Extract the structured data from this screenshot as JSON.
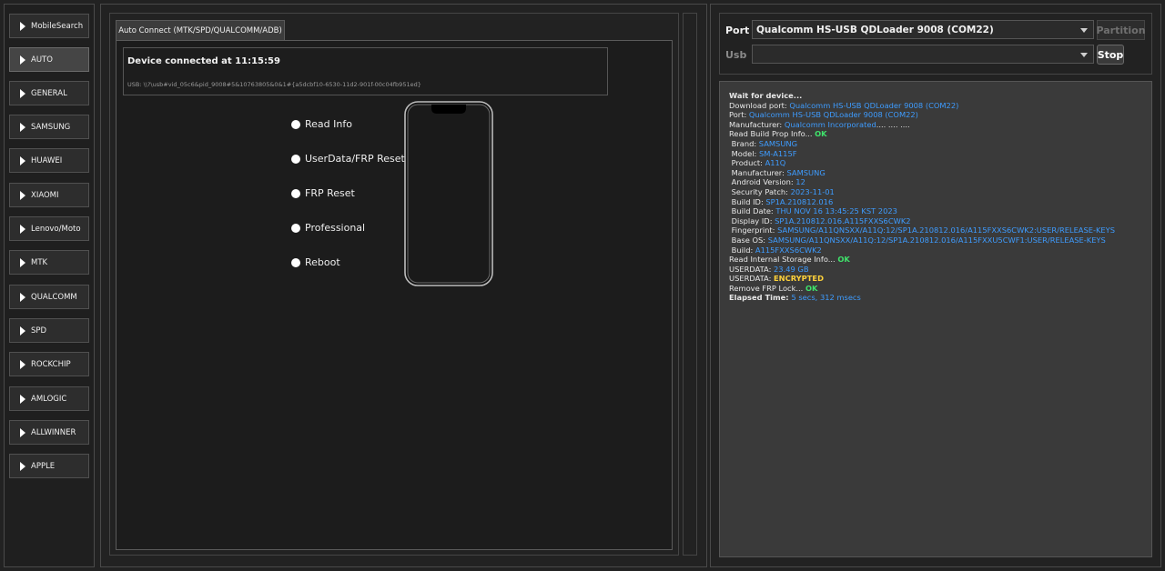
{
  "sidebar": {
    "items": [
      {
        "label": "MobileSearch"
      },
      {
        "label": "AUTO"
      },
      {
        "label": "GENERAL"
      },
      {
        "label": "SAMSUNG"
      },
      {
        "label": "HUAWEI"
      },
      {
        "label": "XIAOMI"
      },
      {
        "label": "Lenovo/Moto"
      },
      {
        "label": "MTK"
      },
      {
        "label": "QUALCOMM"
      },
      {
        "label": "SPD"
      },
      {
        "label": "ROCKCHIP"
      },
      {
        "label": "AMLOGIC"
      },
      {
        "label": "ALLWINNER"
      },
      {
        "label": "APPLE"
      }
    ],
    "active": "AUTO"
  },
  "main": {
    "tab_label": "Auto Connect (MTK/SPD/QUALCOMM/ADB)",
    "status_title": "Device connected at 11:15:59",
    "usb_path": "USB: \\\\?\\usb#vid_05c6&pid_9008#5&10763805&0&1#{a5dcbf10-6530-11d2-901f-00c04fb951ed}",
    "options": [
      {
        "label": "Read Info"
      },
      {
        "label": "UserData/FRP Reset"
      },
      {
        "label": "FRP Reset"
      },
      {
        "label": "Professional"
      },
      {
        "label": "Reboot"
      }
    ]
  },
  "right": {
    "port_label": "Port",
    "port_value": "Qualcomm HS-USB QDLoader 9008 (COM22)",
    "usb_label": "Usb",
    "usb_value": "",
    "partition_label": "Partition",
    "stop_label": "Stop",
    "colors": {
      "value": "#3e9cff",
      "ok": "#3fe36b",
      "warn": "#ffd23a"
    }
  },
  "log": [
    {
      "key": "Wait for device...",
      "bold": true
    },
    {
      "key": "Download port: ",
      "value": "Qualcomm HS-USB QDLoader 9008 (COM22)"
    },
    {
      "key": "Port: ",
      "value": "Qualcomm HS-USB QDLoader 9008 (COM22)"
    },
    {
      "key": "Manufacturer: ",
      "value": "Qualcomm Incorporated",
      "tail": ".... .... ...."
    },
    {
      "key": "Read Build Prop Info... ",
      "ok": "OK"
    },
    {
      "key": " Brand: ",
      "value": "SAMSUNG"
    },
    {
      "key": " Model: ",
      "value": "SM-A115F"
    },
    {
      "key": " Product: ",
      "value": "A11Q"
    },
    {
      "key": " Manufacturer: ",
      "value": "SAMSUNG"
    },
    {
      "key": " Android Version: ",
      "value": "12"
    },
    {
      "key": " Security Patch: ",
      "value": "2023-11-01"
    },
    {
      "key": " Build ID: ",
      "value": "SP1A.210812.016"
    },
    {
      "key": " Build Date: ",
      "value": "THU NOV 16 13:45:25 KST 2023"
    },
    {
      "key": " Display ID: ",
      "value": "SP1A.210812.016.A115FXXS6CWK2"
    },
    {
      "key": " Fingerprint: ",
      "value": "SAMSUNG/A11QNSXX/A11Q:12/SP1A.210812.016/A115FXXS6CWK2:USER/RELEASE-KEYS"
    },
    {
      "key": " Base OS: ",
      "value": "SAMSUNG/A11QNSXX/A11Q:12/SP1A.210812.016/A115FXXU5CWF1:USER/RELEASE-KEYS"
    },
    {
      "key": " Build: ",
      "value": "A115FXXS6CWK2"
    },
    {
      "key": "Read Internal Storage Info... ",
      "ok": "OK"
    },
    {
      "key": "USERDATA: ",
      "value": "23.49 GB"
    },
    {
      "key": "USERDATA: ",
      "warn": "ENCRYPTED"
    },
    {
      "key": "Remove FRP Lock... ",
      "ok": "OK"
    },
    {
      "key": "Elapsed Time: ",
      "value": "5 secs, 312 msecs",
      "bold": true
    }
  ]
}
